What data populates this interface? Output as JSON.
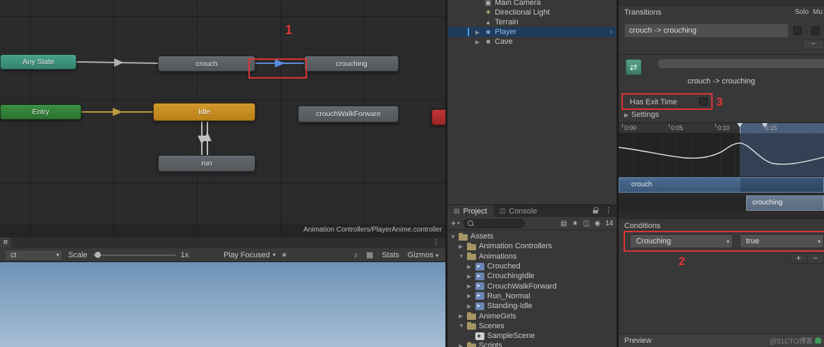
{
  "colors": {
    "annotation_red": "#e03434",
    "selection_blue": "#4f9ee8",
    "prefab_text_blue": "#8fbbea",
    "transition_selected_blue": "#5a8dde",
    "node_teal": "#3f947d",
    "node_green": "#2f8035",
    "node_orange": "#c98a24",
    "node_gray": "#5a5f64",
    "node_red": "#b12f2f"
  },
  "icons": {
    "dropdown_arrow": "▾",
    "menu_dots": "⋮",
    "burst": "∗",
    "mute_audio": "♪",
    "grid": "▦",
    "eye": "◉",
    "filter_type": "▤",
    "filter_label": "★",
    "filter_saved": "◫",
    "project_tab": "▤",
    "console_tab": "◫"
  },
  "animator": {
    "nodes": {
      "any_state": "Any State",
      "crouch": "crouch",
      "crouching": "crouching",
      "entry": "Entry",
      "idle": "Idle",
      "crouch_walk": "crouchWalkForware",
      "run": "run"
    },
    "controller_path": "Animation Controllers/PlayerAnime.controller",
    "annotation_1": "1"
  },
  "game_view": {
    "tab_label": "e",
    "aspect_value": "ct",
    "scale_label": "Scale",
    "scale_value": "1x",
    "play_focused_label": "Play Focused",
    "stats_label": "Stats",
    "gizmos_label": "Gizmos"
  },
  "hierarchy": {
    "items": [
      {
        "fold": "",
        "icon": "camera",
        "label": "Main Camera"
      },
      {
        "fold": "",
        "icon": "light",
        "label": "Directional Light"
      },
      {
        "fold": "",
        "icon": "terrain",
        "label": "Terrain"
      },
      {
        "fold": "▶",
        "icon": "player",
        "label": "Player",
        "selected": true,
        "chev": "›"
      },
      {
        "fold": "▶",
        "icon": "cave",
        "label": "Cave"
      }
    ]
  },
  "project": {
    "tabs": [
      {
        "label": "Project"
      },
      {
        "label": "Console"
      }
    ],
    "hidden_count": "14",
    "tree": [
      {
        "indent": 0,
        "fold": "▼",
        "icon": "folder",
        "label": "Assets"
      },
      {
        "indent": 1,
        "fold": "▶",
        "icon": "folder",
        "label": "Animation Controllers"
      },
      {
        "indent": 1,
        "fold": "▼",
        "icon": "folder",
        "label": "Animations"
      },
      {
        "indent": 2,
        "fold": "▶",
        "icon": "clip",
        "label": "Crouched"
      },
      {
        "indent": 2,
        "fold": "▶",
        "icon": "clip",
        "label": "CrouchingIdle"
      },
      {
        "indent": 2,
        "fold": "▶",
        "icon": "clip",
        "label": "CrouchWalkForward"
      },
      {
        "indent": 2,
        "fold": "▶",
        "icon": "clip",
        "label": "Run_Normal"
      },
      {
        "indent": 2,
        "fold": "▶",
        "icon": "clip",
        "label": "Standing-Idle"
      },
      {
        "indent": 1,
        "fold": "▶",
        "icon": "folder",
        "label": "AnimeGirls"
      },
      {
        "indent": 1,
        "fold": "▼",
        "icon": "folder",
        "label": "Scenes"
      },
      {
        "indent": 2,
        "fold": "",
        "icon": "scene",
        "label": "SampleScene"
      },
      {
        "indent": 1,
        "fold": "▶",
        "icon": "folder",
        "label": "Scripts"
      }
    ]
  },
  "inspector": {
    "transitions_header": "Transitions",
    "solo_label": "Solo",
    "mute_label": "Mu",
    "transition_row": "crouch -> crouching",
    "remove_transition_label": "−",
    "transition_title": "crouch -> crouching",
    "has_exit_time_label": "Has Exit Time",
    "settings_label": "Settings",
    "timeline_ticks": [
      {
        "label": "0:00"
      },
      {
        "label": "0:05"
      },
      {
        "label": "0:10"
      },
      {
        "label": "0:15"
      }
    ],
    "source_state": "crouch",
    "destination_state": "crouching",
    "conditions_header": "Conditions",
    "condition_parameter": "Crouching",
    "condition_value": "true",
    "add_condition_label": "+",
    "remove_condition_label": "−",
    "preview_label": "Preview",
    "annotation_2": "2",
    "annotation_3": "3"
  },
  "watermark": "@51CTO博客"
}
